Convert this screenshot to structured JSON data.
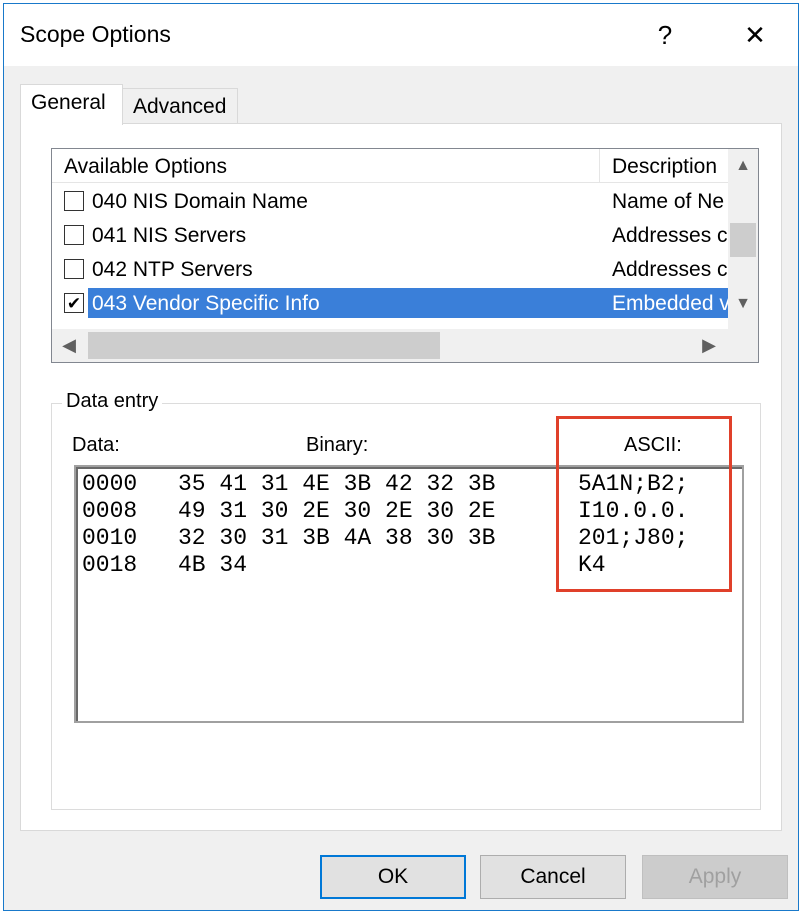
{
  "window": {
    "title": "Scope Options",
    "help_glyph": "?",
    "close_glyph": "✕"
  },
  "tabs": [
    {
      "label": "General",
      "active": true
    },
    {
      "label": "Advanced",
      "active": false
    }
  ],
  "options_list": {
    "columns": [
      "Available Options",
      "Description"
    ],
    "rows": [
      {
        "checked": false,
        "name": "040 NIS Domain Name",
        "description": "Name of Ne"
      },
      {
        "checked": false,
        "name": "041 NIS Servers",
        "description": "Addresses c"
      },
      {
        "checked": false,
        "name": "042 NTP Servers",
        "description": "Addresses c"
      },
      {
        "checked": true,
        "name": "043 Vendor Specific Info",
        "description": "Embedded v"
      }
    ]
  },
  "data_entry": {
    "group_label": "Data entry",
    "data_label": "Data:",
    "binary_label": "Binary:",
    "ascii_label": "ASCII:",
    "hex_rows": [
      {
        "offset": "0000",
        "bytes": "35 41 31 4E 3B 42 32 3B",
        "ascii": "5A1N;B2;"
      },
      {
        "offset": "0008",
        "bytes": "49 31 30 2E 30 2E 30 2E",
        "ascii": "I10.0.0."
      },
      {
        "offset": "0010",
        "bytes": "32 30 31 3B 4A 38 30 3B",
        "ascii": "201;J80;"
      },
      {
        "offset": "0018",
        "bytes": "4B 34",
        "ascii": "K4"
      }
    ],
    "highlight_color": "#e0402a"
  },
  "buttons": {
    "ok": "OK",
    "cancel": "Cancel",
    "apply": "Apply"
  },
  "colors": {
    "selection": "#3a7fd9",
    "window_border": "#1979ca"
  }
}
